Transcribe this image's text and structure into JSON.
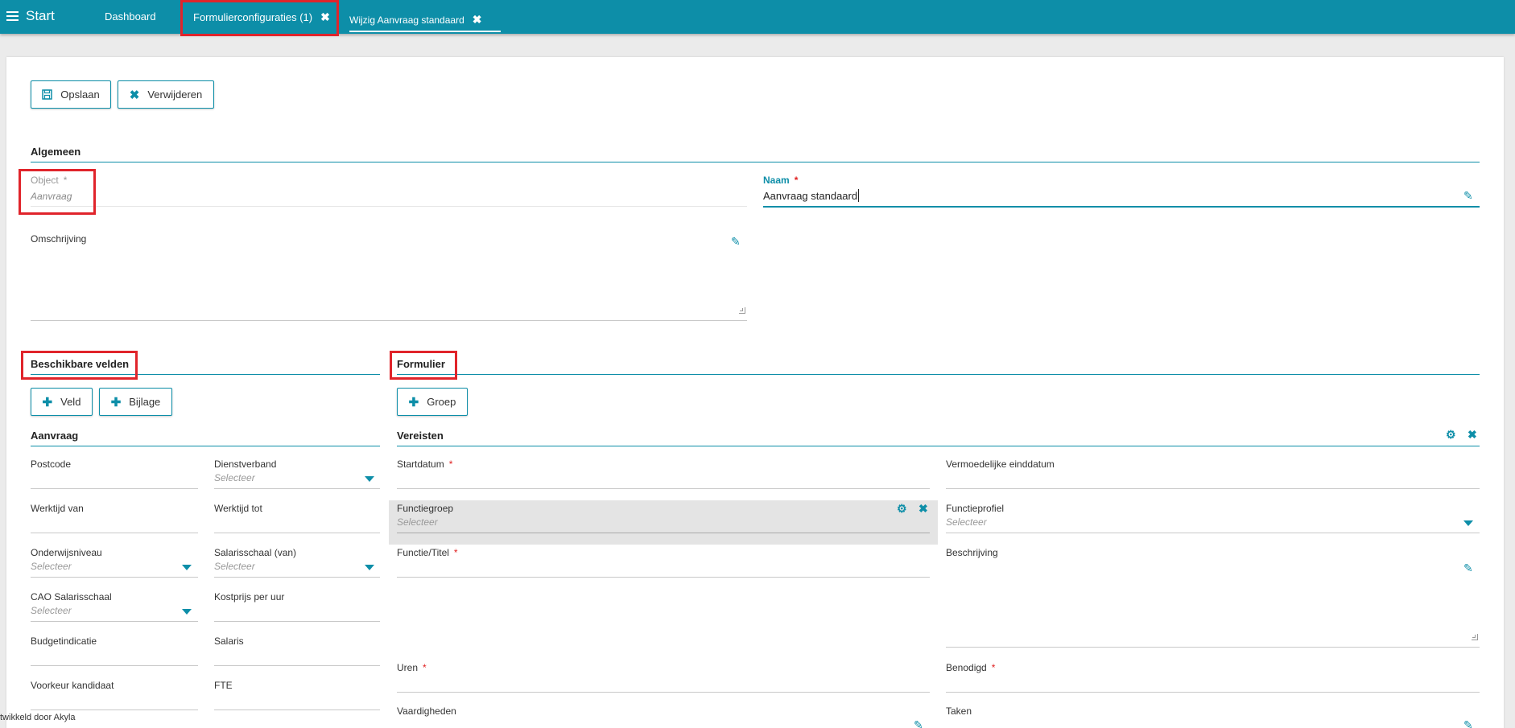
{
  "topbar": {
    "menu_label": "Start",
    "tabs": [
      {
        "label": "Dashboard"
      },
      {
        "label": "Formulierconfiguraties (1)"
      },
      {
        "label": "Wijzig Aanvraag standaard"
      }
    ]
  },
  "toolbar": {
    "save_label": "Opslaan",
    "delete_label": "Verwijderen"
  },
  "algemeen": {
    "title": "Algemeen",
    "object_label": "Object",
    "object_value": "Aanvraag",
    "naam_label": "Naam",
    "naam_value": "Aanvraag standaard",
    "omschrijving_label": "Omschrijving"
  },
  "beschikbare": {
    "title": "Beschikbare velden",
    "add_field_label": "Veld",
    "add_attachment_label": "Bijlage",
    "group_title": "Aanvraag",
    "fields": [
      {
        "label": "Postcode"
      },
      {
        "label": "Dienstverband",
        "placeholder": "Selecteer"
      },
      {
        "label": "Werktijd van"
      },
      {
        "label": "Werktijd tot"
      },
      {
        "label": "Onderwijsniveau",
        "placeholder": "Selecteer"
      },
      {
        "label": "Salarisschaal (van)",
        "placeholder": "Selecteer"
      },
      {
        "label": "CAO Salarisschaal",
        "placeholder": "Selecteer"
      },
      {
        "label": "Kostprijs per uur"
      },
      {
        "label": "Budgetindicatie"
      },
      {
        "label": "Salaris"
      },
      {
        "label": "Voorkeur kandidaat"
      },
      {
        "label": "FTE"
      }
    ]
  },
  "formulier": {
    "title": "Formulier",
    "add_group_label": "Groep",
    "group_title": "Vereisten",
    "fields": {
      "startdatum": "Startdatum",
      "vermoedelijke": "Vermoedelijke einddatum",
      "functiegroep": "Functiegroep",
      "functiegroep_placeholder": "Selecteer",
      "functieprofiel": "Functieprofiel",
      "functieprofiel_placeholder": "Selecteer",
      "functie_titel": "Functie/Titel",
      "beschrijving": "Beschrijving",
      "uren": "Uren",
      "benodigd": "Benodigd",
      "vaardigheden": "Vaardigheden",
      "taken": "Taken"
    }
  },
  "required_mark": "*",
  "footer": {
    "text": "twikkeld door Akyla"
  },
  "colors": {
    "accent": "#0d8ea8",
    "highlight": "#e0242b",
    "required": "#e02020"
  }
}
